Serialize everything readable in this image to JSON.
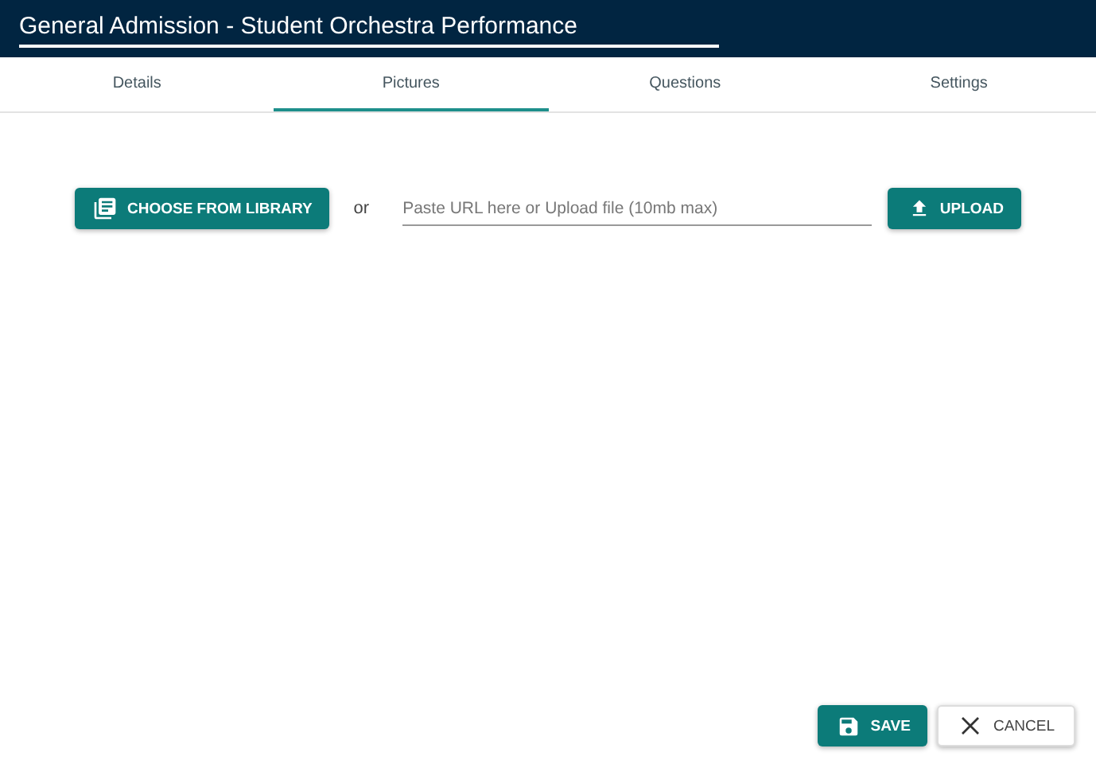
{
  "header": {
    "title": "General Admission - Student Orchestra Performance"
  },
  "tabs": [
    {
      "label": "Details",
      "selected": false
    },
    {
      "label": "Pictures",
      "selected": true
    },
    {
      "label": "Questions",
      "selected": false
    },
    {
      "label": "Settings",
      "selected": false
    }
  ],
  "pictures": {
    "library_button": "CHOOSE FROM LIBRARY",
    "separator": "or",
    "url_field": {
      "placeholder": "Paste URL here or Upload file (10mb max)"
    },
    "upload_button": "UPLOAD"
  },
  "footer": {
    "save_button": "SAVE",
    "cancel_button": "CANCEL"
  }
}
